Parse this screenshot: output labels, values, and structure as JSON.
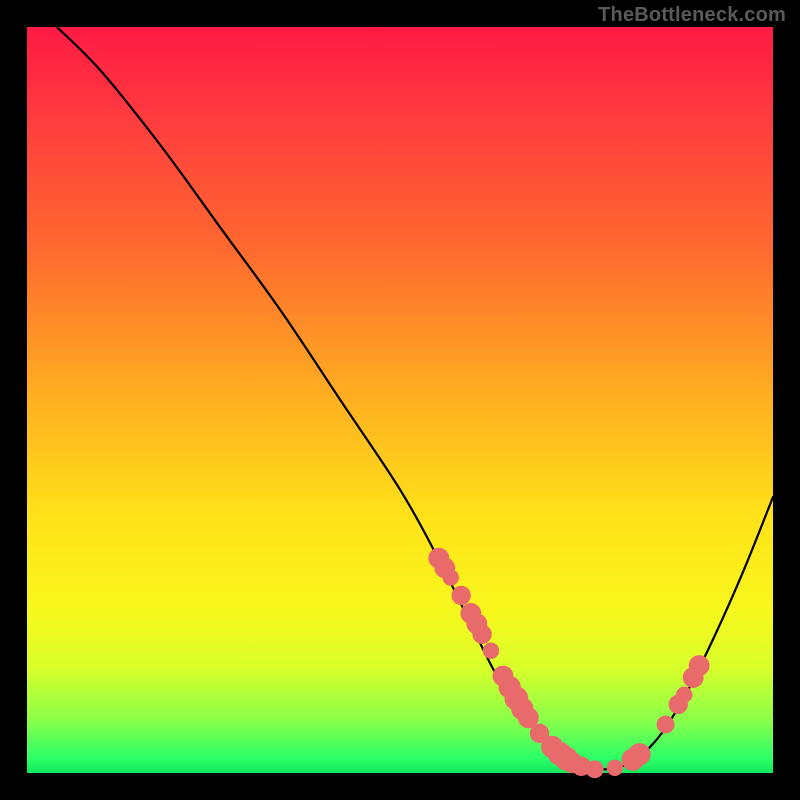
{
  "attribution": "TheBottleneck.com",
  "colors": {
    "marker": "#e86a6a",
    "curve": "#000000",
    "frame": "#000000"
  },
  "chart_data": {
    "type": "line",
    "title": "",
    "xlabel": "",
    "ylabel": "",
    "xlim": [
      0,
      100
    ],
    "ylim": [
      0,
      100
    ],
    "grid": false,
    "series": [
      {
        "name": "bottleneck-curve",
        "x": [
          4,
          10,
          18,
          26,
          34,
          42,
          50,
          55,
          59,
          63,
          67,
          71,
          74,
          77,
          80,
          84,
          88,
          92,
          96,
          100
        ],
        "y": [
          100,
          94,
          84,
          73,
          62,
          50,
          38,
          29,
          21,
          13,
          7,
          3,
          1,
          0.5,
          1,
          4,
          10,
          18,
          27,
          37
        ]
      }
    ],
    "markers": [
      {
        "x": 55.2,
        "y": 28.8,
        "r": 1.4
      },
      {
        "x": 56.0,
        "y": 27.5,
        "r": 1.4
      },
      {
        "x": 56.8,
        "y": 26.2,
        "r": 1.1
      },
      {
        "x": 58.2,
        "y": 23.8,
        "r": 1.3
      },
      {
        "x": 59.5,
        "y": 21.4,
        "r": 1.4
      },
      {
        "x": 60.3,
        "y": 20.0,
        "r": 1.4
      },
      {
        "x": 61.0,
        "y": 18.6,
        "r": 1.3
      },
      {
        "x": 62.2,
        "y": 16.4,
        "r": 1.1
      },
      {
        "x": 63.8,
        "y": 13.0,
        "r": 1.4
      },
      {
        "x": 64.7,
        "y": 11.5,
        "r": 1.5
      },
      {
        "x": 65.6,
        "y": 10.0,
        "r": 1.6
      },
      {
        "x": 66.4,
        "y": 8.6,
        "r": 1.5
      },
      {
        "x": 67.2,
        "y": 7.4,
        "r": 1.4
      },
      {
        "x": 68.7,
        "y": 5.3,
        "r": 1.3
      },
      {
        "x": 70.4,
        "y": 3.5,
        "r": 1.5
      },
      {
        "x": 71.4,
        "y": 2.6,
        "r": 1.6
      },
      {
        "x": 72.3,
        "y": 1.9,
        "r": 1.6
      },
      {
        "x": 73.1,
        "y": 1.4,
        "r": 1.4
      },
      {
        "x": 74.3,
        "y": 0.9,
        "r": 1.3
      },
      {
        "x": 76.1,
        "y": 0.5,
        "r": 1.2
      },
      {
        "x": 78.8,
        "y": 0.7,
        "r": 1.1
      },
      {
        "x": 81.2,
        "y": 1.8,
        "r": 1.5
      },
      {
        "x": 82.1,
        "y": 2.5,
        "r": 1.5
      },
      {
        "x": 85.6,
        "y": 6.5,
        "r": 1.2
      },
      {
        "x": 87.3,
        "y": 9.2,
        "r": 1.3
      },
      {
        "x": 88.1,
        "y": 10.5,
        "r": 1.1
      },
      {
        "x": 89.3,
        "y": 12.8,
        "r": 1.4
      },
      {
        "x": 90.1,
        "y": 14.4,
        "r": 1.4
      }
    ]
  }
}
